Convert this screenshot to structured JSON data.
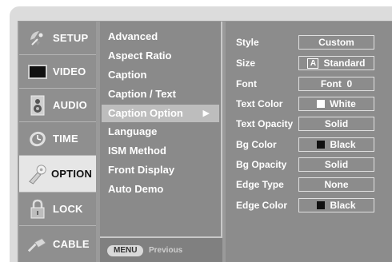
{
  "categories": [
    {
      "label": "SETUP",
      "icon": "satellite-dish-icon"
    },
    {
      "label": "VIDEO",
      "icon": "tv-screen-icon"
    },
    {
      "label": "AUDIO",
      "icon": "speaker-icon"
    },
    {
      "label": "TIME",
      "icon": "clock-icon"
    },
    {
      "label": "OPTION",
      "icon": "option-key-icon"
    },
    {
      "label": "LOCK",
      "icon": "padlock-icon"
    },
    {
      "label": "CABLE",
      "icon": "cable-plug-icon"
    }
  ],
  "active_category": "OPTION",
  "menu": {
    "items": [
      "Advanced",
      "Aspect Ratio",
      "Caption",
      "Caption / Text",
      "Caption Option",
      "Language",
      "ISM Method",
      "Front Display",
      "Auto Demo"
    ],
    "active_item": "Caption Option",
    "arrow": "▶"
  },
  "footer": {
    "button_label": "MENU",
    "hint": "Previous"
  },
  "options": [
    {
      "label": "Style",
      "value": "Custom"
    },
    {
      "label": "Size",
      "value": "Standard",
      "glyph": "A"
    },
    {
      "label": "Font",
      "value": "Font  0"
    },
    {
      "label": "Text Color",
      "value": "White",
      "swatch": "#ffffff"
    },
    {
      "label": "Text Opacity",
      "value": "Solid"
    },
    {
      "label": "Bg Color",
      "value": "Black",
      "swatch": "#111111"
    },
    {
      "label": "Bg Opacity",
      "value": "Solid"
    },
    {
      "label": "Edge Type",
      "value": "None"
    },
    {
      "label": "Edge Color",
      "value": "Black",
      "swatch": "#111111"
    }
  ]
}
